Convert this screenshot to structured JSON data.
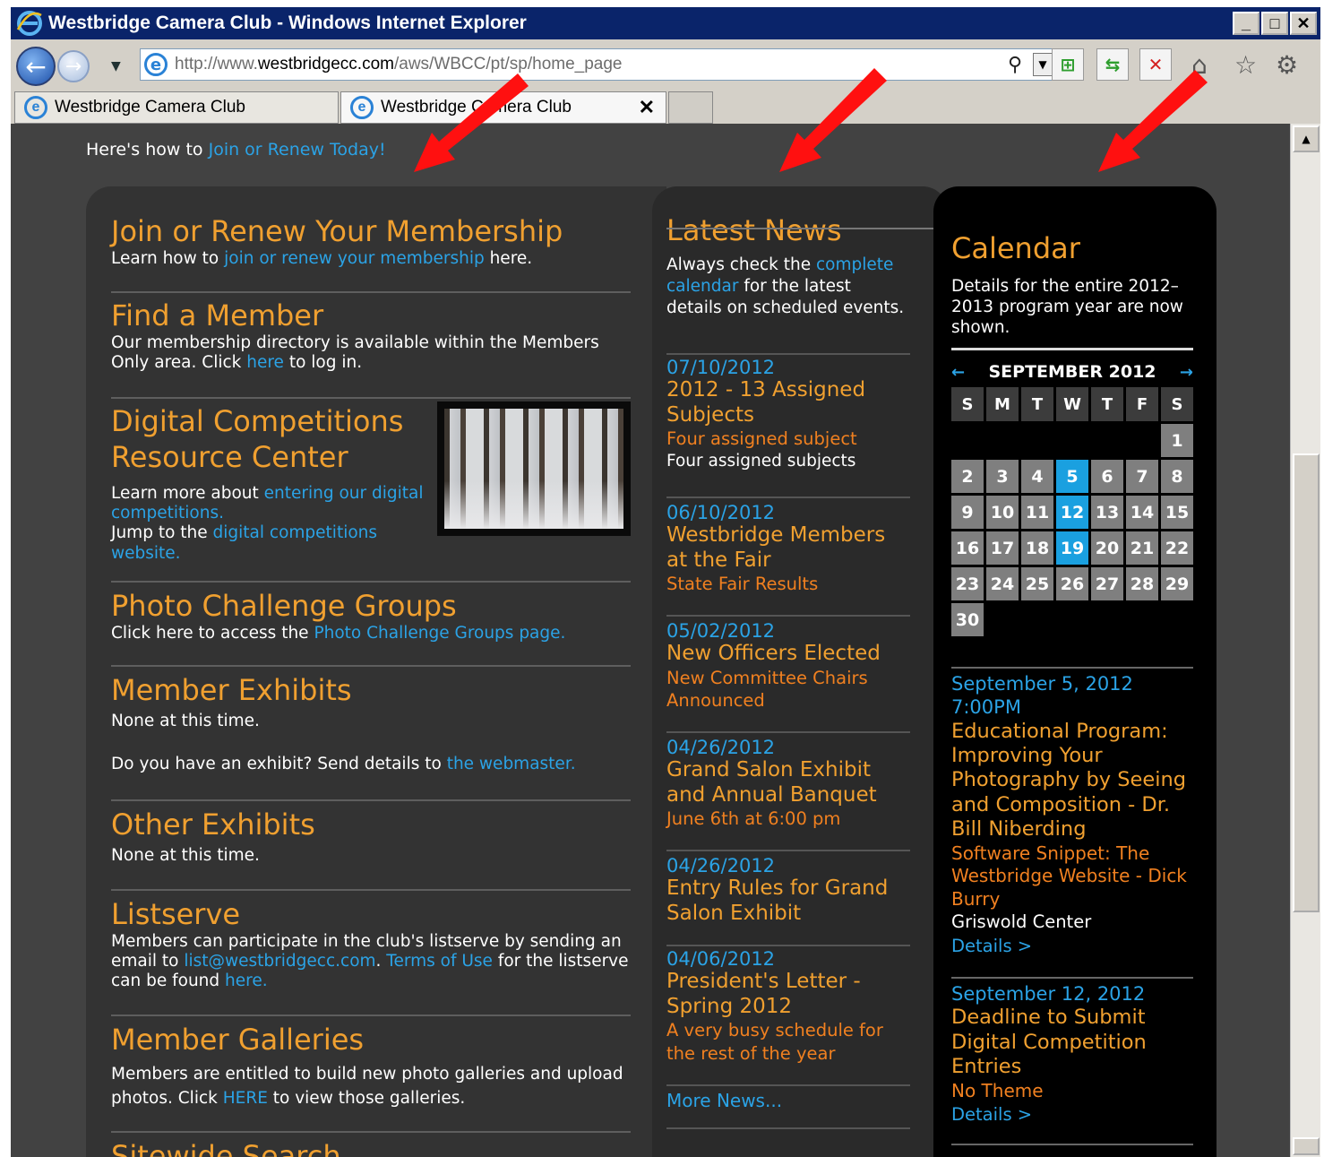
{
  "window": {
    "title": "Westbridge Camera Club - Windows Internet Explorer"
  },
  "address": {
    "url_prefix": "http://www.",
    "url_domain": "westbridgecc.com",
    "url_path": "/aws/WBCC/pt/sp/home_page"
  },
  "tabs": [
    {
      "label": "Westbridge Camera Club"
    },
    {
      "label": "Westbridge Camera Club"
    }
  ],
  "top": {
    "intro": "Here's how to ",
    "intro_link": "Join or Renew Today!"
  },
  "left": {
    "s1": {
      "title": "Join or Renew Your Membership",
      "pre": "Learn how to ",
      "link": "join or renew your membership",
      "post": " here."
    },
    "s2": {
      "title": "Find a Member",
      "pre": "Our membership directory is available within the Members Only area. Click ",
      "link": "here",
      "post": " to log in."
    },
    "s3": {
      "title": "Digital Competitions Resource Center",
      "pre1": "Learn more about ",
      "link1": "entering our digital competitions.",
      "pre2": "Jump to the ",
      "link2": "digital competitions website."
    },
    "s4": {
      "title": "Photo Challenge Groups",
      "pre": "Click here to access the ",
      "link": "Photo Challenge Groups page."
    },
    "s5": {
      "title": "Member Exhibits",
      "none": "None at this time.",
      "pre": "Do you have an exhibit? Send details to ",
      "link": "the webmaster."
    },
    "s6": {
      "title": "Other Exhibits",
      "none": "None at this time."
    },
    "s7": {
      "title": "Listserve",
      "pre": "Members can participate in the club's listserve by sending an email to ",
      "link1": "list@westbridgecc.com",
      "mid": ". ",
      "link2": "Terms of Use",
      "mid2": " for the listserve can be found ",
      "link3": "here."
    },
    "s8": {
      "title": "Member Galleries",
      "pre": "Members are entitled to build new photo galleries and upload photos. Click ",
      "link": "HERE",
      "post": " to view those galleries."
    },
    "s9": {
      "title": "Sitewide Search"
    }
  },
  "news": {
    "title": "Latest News",
    "intro_pre": "Always check the ",
    "intro_link": "complete calendar",
    "intro_post": " for the latest details on scheduled events.",
    "items": [
      {
        "date": "07/10/2012",
        "title": "2012 - 13 Assigned Subjects",
        "sub": "Four assigned subject",
        "text": "Four assigned subjects"
      },
      {
        "date": "06/10/2012",
        "title": "Westbridge Members at the Fair",
        "sub": "State Fair Results"
      },
      {
        "date": "05/02/2012",
        "title": "New Officers Elected",
        "sub": "New Committee Chairs Announced"
      },
      {
        "date": "04/26/2012",
        "title": "Grand Salon Exhibit and Annual Banquet",
        "sub": "June 6th at 6:00 pm"
      },
      {
        "date": "04/26/2012",
        "title": "Entry Rules for Grand Salon Exhibit"
      },
      {
        "date": "04/06/2012",
        "title": "President's Letter - Spring 2012",
        "sub": "A very busy schedule for the rest of the year"
      }
    ],
    "more": "More News..."
  },
  "calendar": {
    "title": "Calendar",
    "desc": "Details for the entire 2012–2013 program year are now shown.",
    "month": "SEPTEMBER 2012",
    "prev": "←",
    "next": "→",
    "weekdays": [
      "S",
      "M",
      "T",
      "W",
      "T",
      "F",
      "S"
    ],
    "days": [
      "1",
      "2",
      "3",
      "4",
      "5",
      "6",
      "7",
      "8",
      "9",
      "10",
      "11",
      "12",
      "13",
      "14",
      "15",
      "16",
      "17",
      "18",
      "19",
      "20",
      "21",
      "22",
      "23",
      "24",
      "25",
      "26",
      "27",
      "28",
      "29",
      "30"
    ],
    "highlighted": [
      "5",
      "12",
      "19"
    ],
    "events": [
      {
        "date": "September 5, 2012",
        "time": "7:00PM",
        "title": "Educational Program: Improving Your Photography by Seeing and Composition - Dr. Bill Niberding",
        "sub": "Software Snippet: The Westbridge Website - Dick Burry",
        "loc": "Griswold Center",
        "details": "Details >"
      },
      {
        "date": "September 12, 2012",
        "title": "Deadline to Submit Digital Competition Entries",
        "sub": "No Theme",
        "details": "Details >"
      }
    ]
  },
  "colors": {
    "accent_orange": "#f0a030",
    "link_blue": "#2ba3e6",
    "annotation_red": "#ff1010",
    "highlight_day": "#1aa0e0"
  }
}
